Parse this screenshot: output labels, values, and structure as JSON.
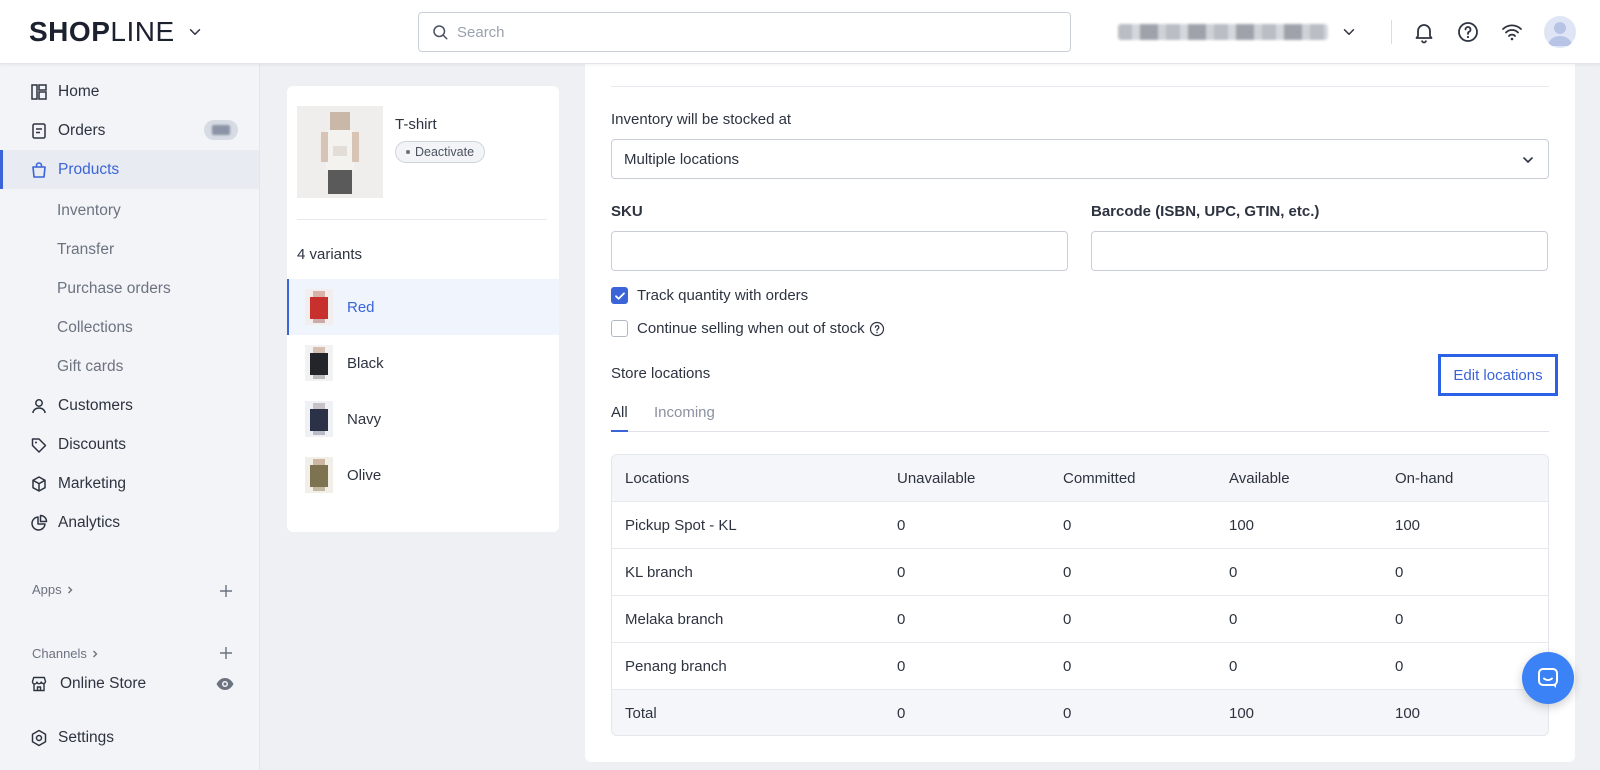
{
  "topbar": {
    "logo_bold": "SH",
    "logo_o": "O",
    "logo_p": "P",
    "logo_line": "LINE",
    "search_placeholder": "Search"
  },
  "sidebar": {
    "items": {
      "home": "Home",
      "orders": "Orders",
      "products": "Products",
      "inventory": "Inventory",
      "transfer": "Transfer",
      "purchase_orders": "Purchase orders",
      "collections": "Collections",
      "gift_cards": "Gift cards",
      "customers": "Customers",
      "discounts": "Discounts",
      "marketing": "Marketing",
      "analytics": "Analytics",
      "online_store": "Online Store",
      "settings": "Settings"
    },
    "apps_label": "Apps",
    "channels_label": "Channels"
  },
  "product": {
    "title": "T-shirt",
    "status": "Deactivate",
    "variants_count": "4 variants",
    "variants": [
      {
        "name": "Red",
        "color": "#c8302e"
      },
      {
        "name": "Black",
        "color": "#23252a"
      },
      {
        "name": "Navy",
        "color": "#2b3247"
      },
      {
        "name": "Olive",
        "color": "#7d7350"
      }
    ]
  },
  "form": {
    "stock_label": "Inventory will be stocked at",
    "stock_value": "Multiple locations",
    "sku_label": "SKU",
    "barcode_label": "Barcode (ISBN, UPC, GTIN, etc.)",
    "track_label": "Track quantity with orders",
    "track_checked": true,
    "continue_label": "Continue selling when out of stock",
    "continue_checked": false
  },
  "locations": {
    "title": "Store locations",
    "edit_label": "Edit locations",
    "tabs": [
      "All",
      "Incoming"
    ],
    "active_tab": "All",
    "columns": [
      "Locations",
      "Unavailable",
      "Committed",
      "Available",
      "On-hand"
    ],
    "rows": [
      [
        "Pickup Spot - KL",
        "0",
        "0",
        "100",
        "100"
      ],
      [
        "KL branch",
        "0",
        "0",
        "0",
        "0"
      ],
      [
        "Melaka branch",
        "0",
        "0",
        "0",
        "0"
      ],
      [
        "Penang branch",
        "0",
        "0",
        "0",
        "0"
      ]
    ],
    "total": [
      "Total",
      "0",
      "0",
      "100",
      "100"
    ]
  },
  "colors": {
    "accent": "#3a64d8",
    "highlight_border": "#2c63e6",
    "chat": "#3b82f6"
  }
}
